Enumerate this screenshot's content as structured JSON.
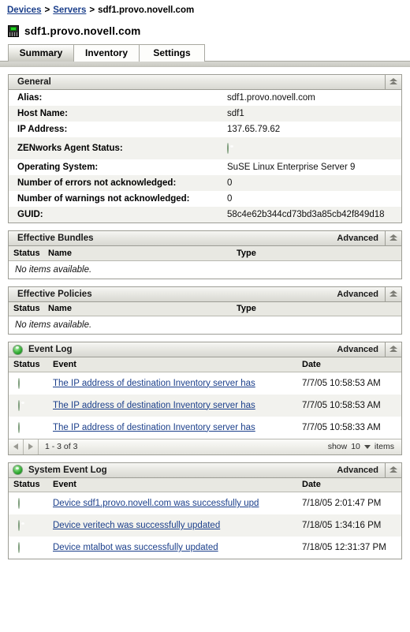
{
  "breadcrumb": {
    "items": [
      {
        "label": "Devices",
        "link": true
      },
      {
        "label": "Servers",
        "link": true
      },
      {
        "label": "sdf1.provo.novell.com",
        "link": false
      }
    ],
    "separator": ">"
  },
  "page": {
    "title": "sdf1.provo.novell.com",
    "icon": "server-device-icon"
  },
  "tabs": [
    {
      "label": "Summary",
      "active": true
    },
    {
      "label": "Inventory",
      "active": false
    },
    {
      "label": "Settings",
      "active": false
    }
  ],
  "panels": {
    "general": {
      "title": "General",
      "collapse_icon": "chevron-up-double-icon",
      "rows": [
        {
          "label": "Alias:",
          "value": "sdf1.provo.novell.com",
          "type": "text"
        },
        {
          "label": "Host Name:",
          "value": "sdf1",
          "type": "text"
        },
        {
          "label": "IP Address:",
          "value": "137.65.79.62",
          "type": "text"
        },
        {
          "label": "ZENworks Agent Status:",
          "value": "",
          "type": "status",
          "status": "green"
        },
        {
          "label": "Operating System:",
          "value": "SuSE Linux Enterprise Server 9",
          "type": "text"
        },
        {
          "label": "Number of errors not acknowledged:",
          "value": "0",
          "type": "text"
        },
        {
          "label": "Number of warnings not acknowledged:",
          "value": "0",
          "type": "text"
        },
        {
          "label": "GUID:",
          "value": "58c4e62b344cd73bd3a85cb42f849d18",
          "type": "text"
        }
      ]
    },
    "effective_bundles": {
      "title": "Effective Bundles",
      "advanced_label": "Advanced",
      "collapse_icon": "chevron-up-double-icon",
      "columns": [
        "Status",
        "Name",
        "Type"
      ],
      "empty_text": "No items available.",
      "rows": []
    },
    "effective_policies": {
      "title": "Effective Policies",
      "advanced_label": "Advanced",
      "collapse_icon": "chevron-up-double-icon",
      "columns": [
        "Status",
        "Name",
        "Type"
      ],
      "empty_text": "No items available.",
      "rows": []
    },
    "event_log": {
      "title": "Event Log",
      "header_status": "green",
      "advanced_label": "Advanced",
      "collapse_icon": "chevron-up-double-icon",
      "columns": [
        "Status",
        "Event",
        "Date"
      ],
      "rows": [
        {
          "status": "green",
          "event": "The IP address of destination Inventory server has",
          "date": "7/7/05 10:58:53 AM"
        },
        {
          "status": "green",
          "event": "The IP address of destination Inventory server has",
          "date": "7/7/05 10:58:53 AM"
        },
        {
          "status": "green",
          "event": "The IP address of destination Inventory server has",
          "date": "7/7/05 10:58:33 AM"
        }
      ],
      "pager": {
        "prev_icon": "triangle-left-icon",
        "next_icon": "triangle-right-icon",
        "range": "1 - 3 of 3",
        "show_label": "show",
        "page_size": "10",
        "items_label": "items",
        "caret_icon": "caret-down-icon"
      }
    },
    "system_event_log": {
      "title": "System Event Log",
      "header_status": "green",
      "advanced_label": "Advanced",
      "collapse_icon": "chevron-up-double-icon",
      "columns": [
        "Status",
        "Event",
        "Date"
      ],
      "rows": [
        {
          "status": "green",
          "event": "Device sdf1.provo.novell.com was successfully upd",
          "date": "7/18/05 2:01:47 PM"
        },
        {
          "status": "green",
          "event": "Device veritech was successfully updated",
          "date": "7/18/05 1:34:16 PM"
        },
        {
          "status": "green",
          "event": "Device mtalbot was successfully updated",
          "date": "7/18/05 12:31:37 PM"
        }
      ]
    }
  },
  "colors": {
    "link": "#1b3f8b",
    "status_green": "#2ca82c",
    "panel_border": "#9d9d95",
    "row_alt": "#f2f2ee"
  }
}
